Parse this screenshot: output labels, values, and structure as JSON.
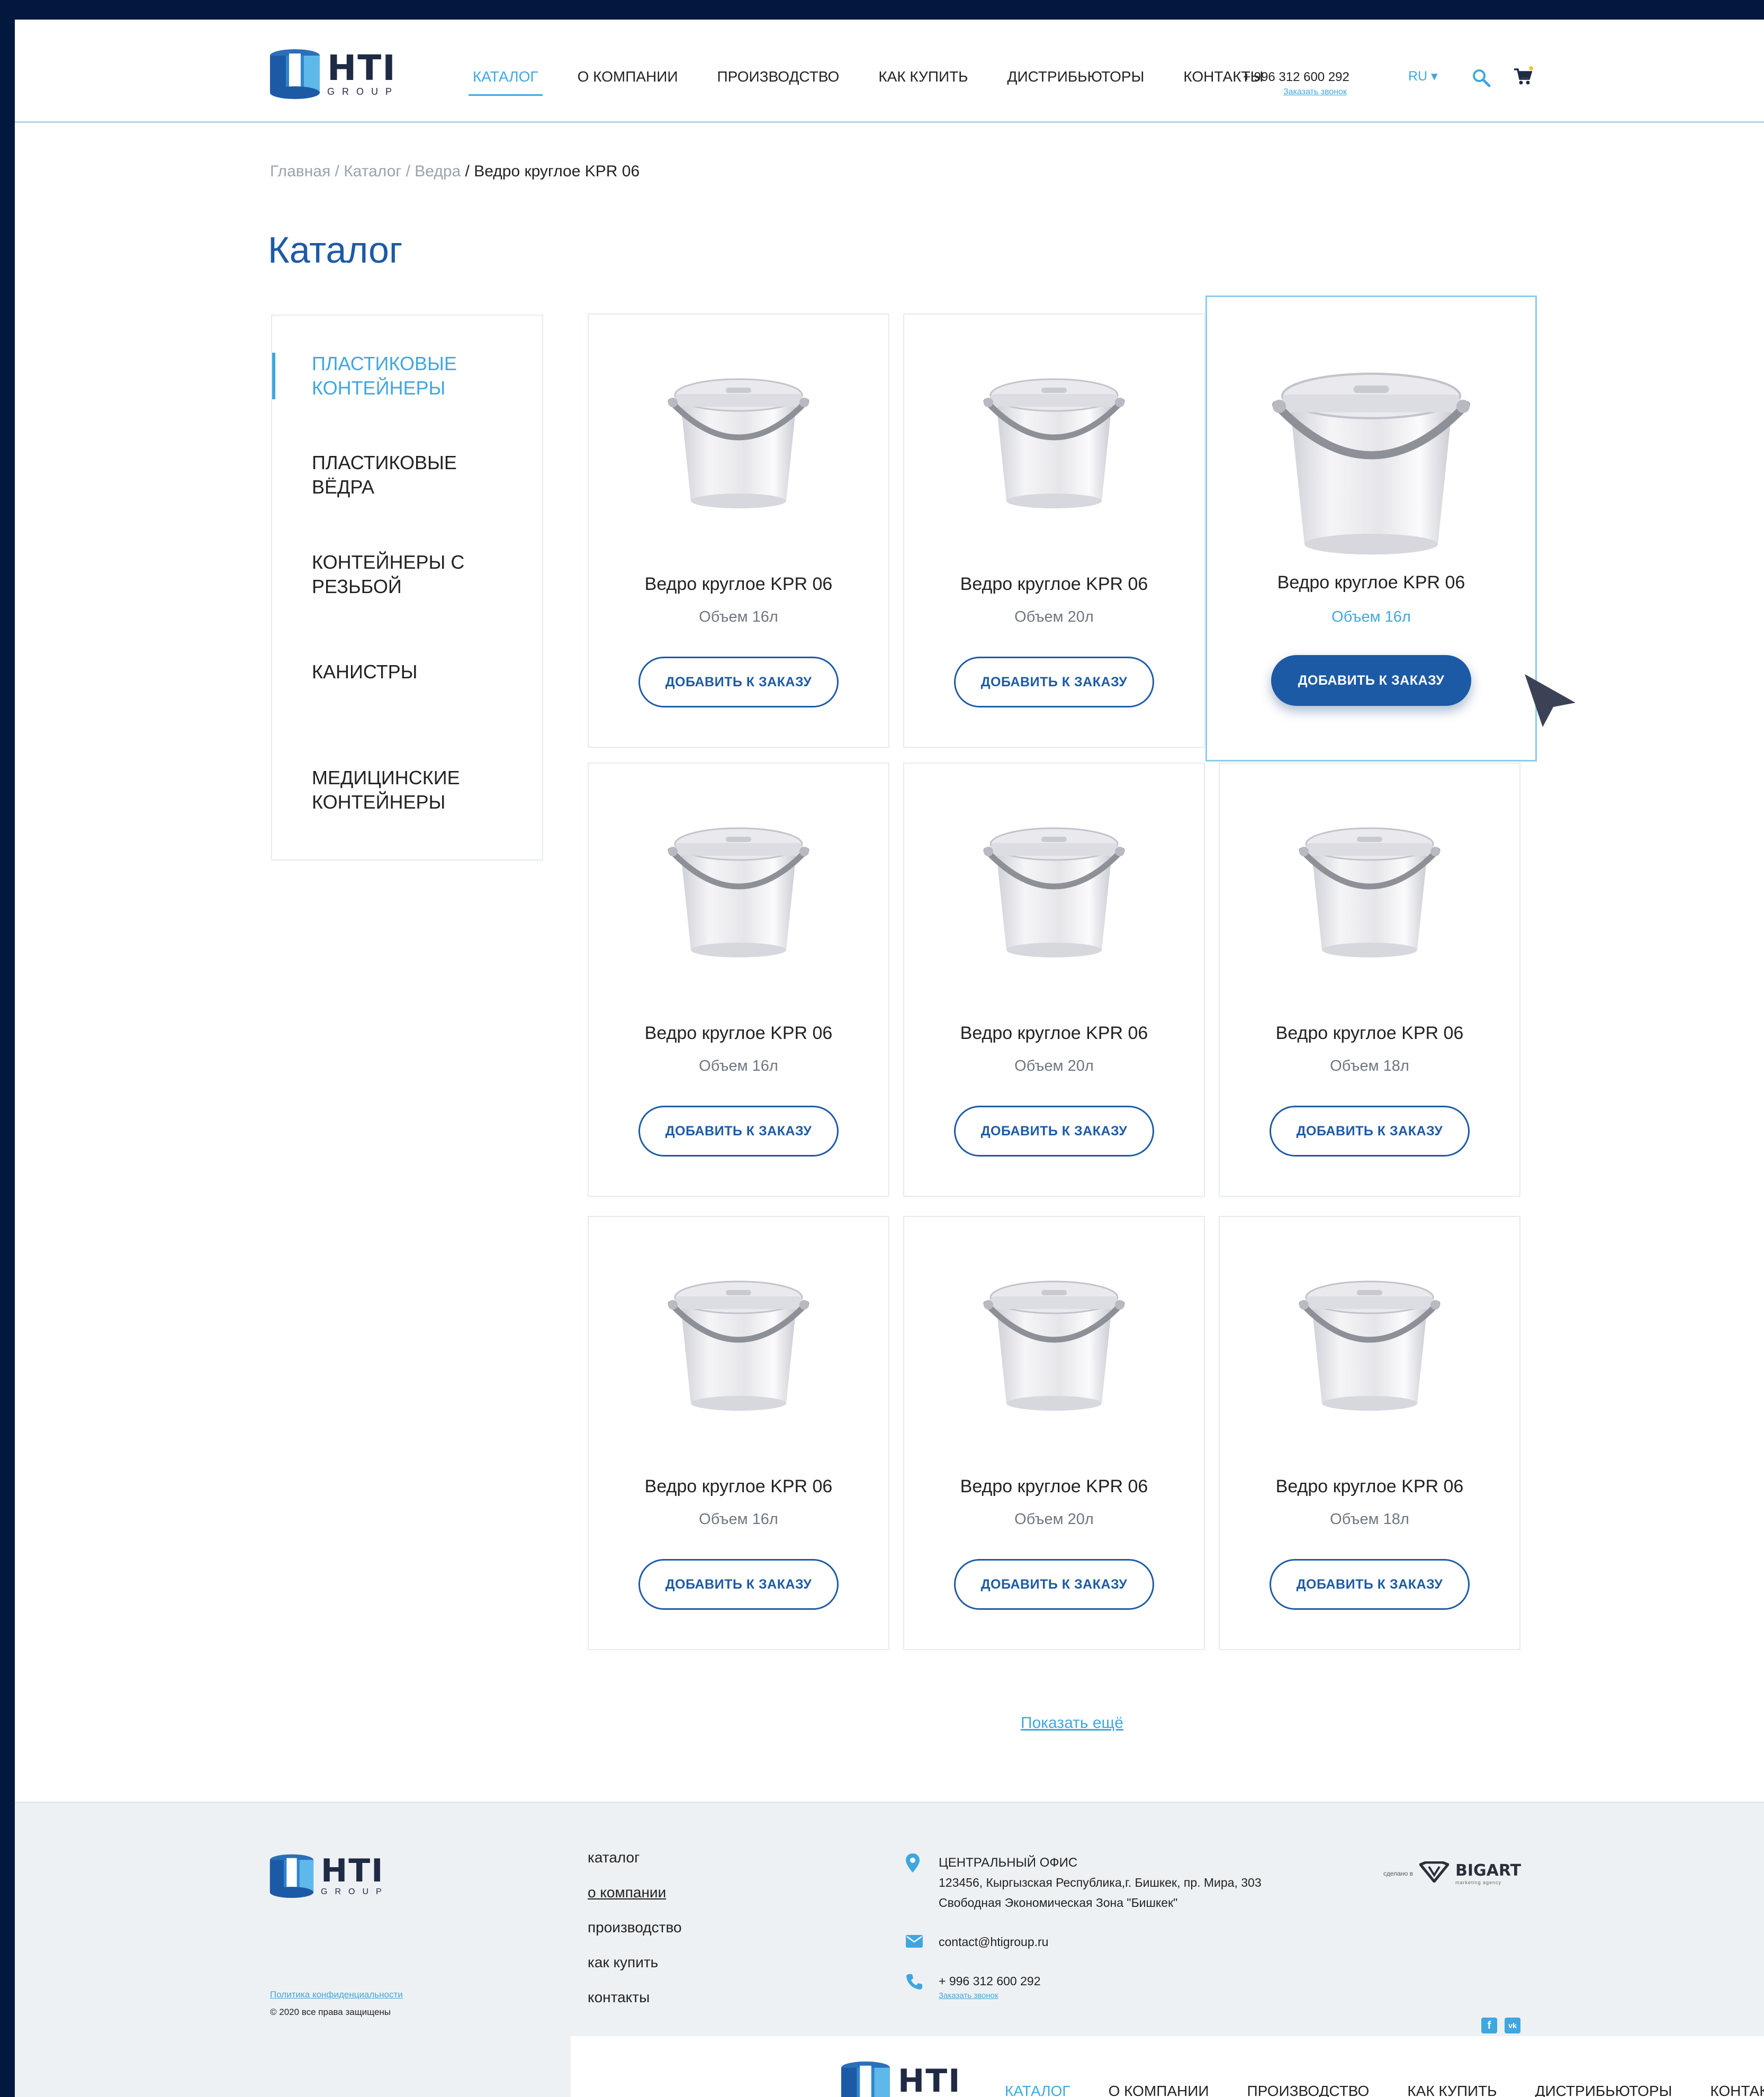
{
  "brand": {
    "name": "HTI",
    "group": "GROUP"
  },
  "nav": [
    {
      "label": "КАТАЛОГ",
      "active": true
    },
    {
      "label": "О КОМПАНИИ"
    },
    {
      "label": "ПРОИЗВОДСТВО"
    },
    {
      "label": "КАК КУПИТЬ"
    },
    {
      "label": "ДИСТРИБЬЮТОРЫ"
    },
    {
      "label": "КОНТАКТЫ"
    }
  ],
  "header": {
    "phone": "+ 996 312 600 292",
    "callback": "Заказать звонок",
    "lang": "RU ▾",
    "search_icon": "search-icon",
    "cart_icon": "cart-icon"
  },
  "breadcrumb": {
    "home": "Главная",
    "catalog": "Каталог",
    "category": "Ведра",
    "current": "Ведро круглое KPR 06",
    "sep": " / "
  },
  "page_title": "Каталог",
  "sidebar": [
    {
      "label": "ПЛАСТИКОВЫЕ КОНТЕЙНЕРЫ",
      "active": true
    },
    {
      "label": "ПЛАСТИКОВЫЕ ВЁДРА"
    },
    {
      "label": "КОНТЕЙНЕРЫ С РЕЗЬБОЙ"
    },
    {
      "label": "КАНИСТРЫ"
    },
    {
      "label": "МЕДИЦИНСКИЕ КОНТЕЙНЕРЫ"
    }
  ],
  "products": [
    {
      "name": "Ведро круглое KPR 06",
      "volume": "Объем 16л",
      "button": "ДОБАВИТЬ К ЗАКАЗУ"
    },
    {
      "name": "Ведро круглое KPR 06",
      "volume": "Объем 20л",
      "button": "ДОБАВИТЬ К ЗАКАЗУ"
    },
    {
      "name": "Ведро круглое KPR 06",
      "volume": "Объем 16л",
      "button": "ДОБАВИТЬ К ЗАКАЗУ",
      "hovered": true
    },
    {
      "name": "Ведро круглое KPR 06",
      "volume": "Объем 16л",
      "button": "ДОБАВИТЬ К ЗАКАЗУ"
    },
    {
      "name": "Ведро круглое KPR 06",
      "volume": "Объем 20л",
      "button": "ДОБАВИТЬ К ЗАКАЗУ"
    },
    {
      "name": "Ведро круглое KPR 06",
      "volume": "Объем 18л",
      "button": "ДОБАВИТЬ К ЗАКАЗУ"
    },
    {
      "name": "Ведро круглое KPR 06",
      "volume": "Объем 16л",
      "button": "ДОБАВИТЬ К ЗАКАЗУ"
    },
    {
      "name": "Ведро круглое KPR 06",
      "volume": "Объем 20л",
      "button": "ДОБАВИТЬ К ЗАКАЗУ"
    },
    {
      "name": "Ведро круглое KPR 06",
      "volume": "Объем 18л",
      "button": "ДОБАВИТЬ К ЗАКАЗУ"
    }
  ],
  "show_more": "Показать ещё",
  "footer": {
    "nav": [
      "каталог",
      "о компании",
      "производство",
      "как купить",
      "контакты"
    ],
    "office_title": "ЦЕНТРАЛЬНЫЙ ОФИС",
    "address_line1": "123456, Кыргызская Республика,г. Бишкек, пр. Мира, 303",
    "address_line2": "Свободная Экономическая Зона \"Бишкек\"",
    "email": "contact@htigroup.ru",
    "phone": "+ 996 312 600 292",
    "callback": "Заказать звонок",
    "privacy": "Политика конфиденциальности",
    "copyright": "© 2020 все права защищены",
    "made_by": "сделано в",
    "agency": "BIGART",
    "agency_sub": "marketing agency",
    "social": [
      "f",
      "vk"
    ]
  },
  "colors": {
    "accent": "#3fa7df",
    "primary": "#1d5aa6",
    "frame": "#03183e",
    "footer_bg": "#eef1f4"
  }
}
